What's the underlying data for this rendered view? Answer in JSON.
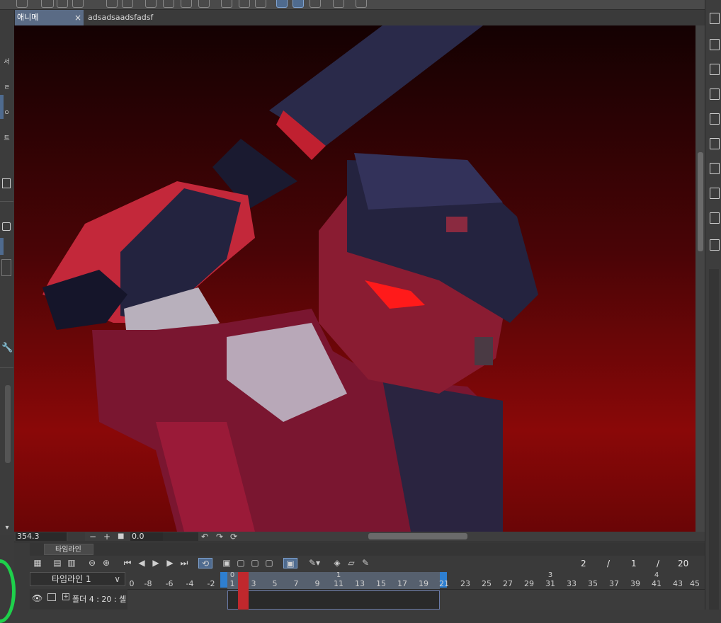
{
  "tabs": [
    {
      "label": "애니메",
      "close": "×",
      "active": true
    },
    {
      "label": "adsadsaadsfadsf",
      "close": "",
      "active": false
    }
  ],
  "left_strip": {
    "items": [
      "서",
      "ㄹ",
      "ㄹ",
      "ㅇ",
      "트"
    ]
  },
  "status": {
    "zoom": "354.3",
    "minus": "−",
    "plus": "+",
    "stop": "■",
    "rotation": "0.0",
    "rotate_left_icon": "↶",
    "rotate_right_icon": "↷",
    "reset_icon": "⟳"
  },
  "timeline": {
    "panel_title": "타임라인",
    "selector_value": "타임라인 1",
    "frame_current": "2",
    "frame_sep1": "/",
    "frame_second": "1",
    "frame_sep2": "/",
    "frame_total": "20",
    "track_label": "폴더 4 : 20 : 셀",
    "ruler_numbers": [
      "0",
      "-8",
      "-6",
      "-4",
      "-2",
      "1",
      "2",
      "3",
      "5",
      "7",
      "9",
      "11",
      "13",
      "15",
      "17",
      "19",
      "21",
      "23",
      "25",
      "27",
      "29",
      "31",
      "33",
      "35",
      "37",
      "39",
      "41",
      "43",
      "45"
    ],
    "ruler_top_labels": [
      "0",
      "1",
      "3",
      "4"
    ],
    "tool_icons": [
      "timeline-panel-icon",
      "new-frame-icon",
      "frame-settings-icon",
      "zoom-out-icon",
      "zoom-in-icon",
      "first-frame-icon",
      "prev-frame-icon",
      "play-icon",
      "next-frame-icon",
      "last-frame-icon",
      "loop-icon",
      "new-animation-folder-icon",
      "new-cel-icon",
      "cel-icon",
      "onion-skin-icon",
      "light-table-icon",
      "link-icon",
      "keyframe-icon",
      "camera-icon",
      "pen-icon"
    ]
  },
  "colors": {
    "accent": "#4f6b8f",
    "playhead": "#c0282d",
    "marker": "#2e7fd0",
    "canvas_bg": "#1a0203"
  }
}
